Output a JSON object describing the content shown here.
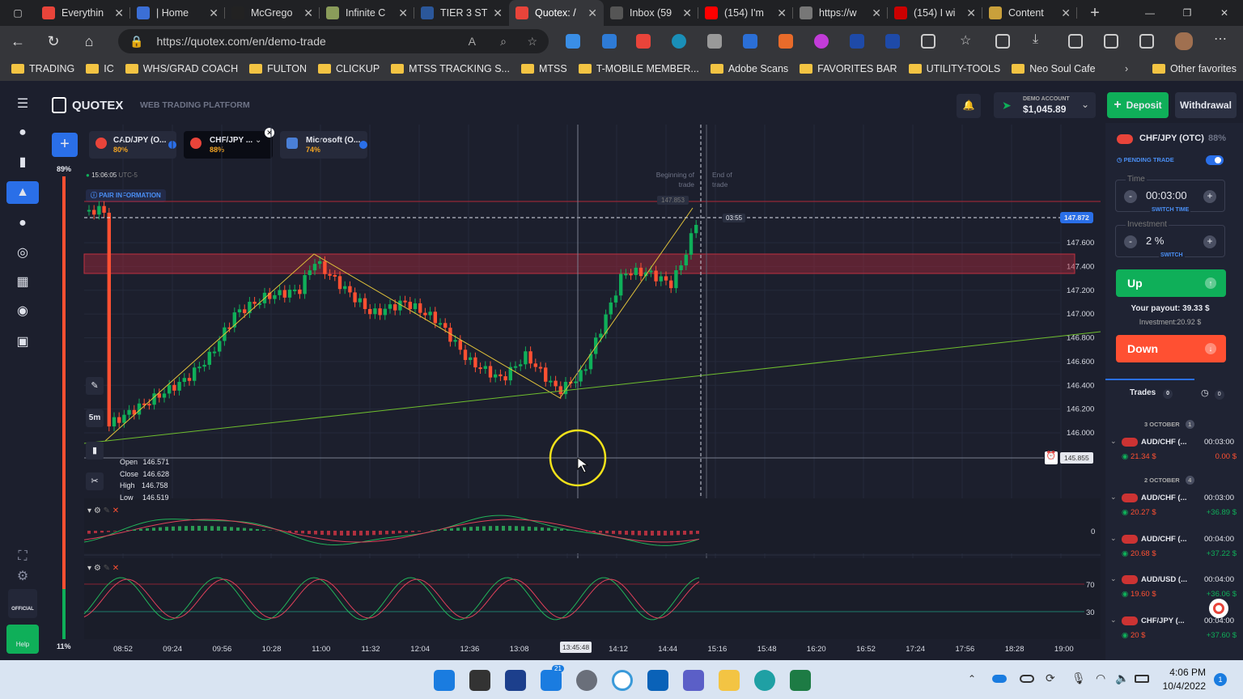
{
  "browser": {
    "tabs": [
      {
        "title": "Everythin",
        "color": "#e8443a"
      },
      {
        "title": "| Home",
        "color": "#3b6fd6"
      },
      {
        "title": "McGrego",
        "color": "#222"
      },
      {
        "title": "Infinite C",
        "color": "#8a9c5a"
      },
      {
        "title": "TIER 3 ST",
        "color": "#2b579a"
      },
      {
        "title": "Quotex: /",
        "color": "#e8443a"
      },
      {
        "title": "Inbox (59",
        "color": "#555"
      },
      {
        "title": "(154) I'm",
        "color": "#ff0000"
      },
      {
        "title": "https://w",
        "color": "#777"
      },
      {
        "title": "(154) I wi",
        "color": "#c00"
      },
      {
        "title": "Content",
        "color": "#c9a03b"
      }
    ],
    "url": "https://quotex.com/en/demo-trade",
    "favorites": [
      "TRADING",
      "IC",
      "WHS/GRAD COACH",
      "FULTON",
      "CLICKUP",
      "MTSS TRACKING S...",
      "MTSS",
      "T-MOBILE MEMBER...",
      "Adobe Scans",
      "FAVORITES BAR",
      "UTILITY-TOOLS",
      "Neo Soul Cafe"
    ],
    "other_favorites": "Other favorites"
  },
  "header": {
    "brand": "QUOTEX",
    "subtitle": "WEB TRADING PLATFORM",
    "account_type": "DEMO ACCOUNT",
    "balance": "$1,045.89",
    "deposit": "Deposit",
    "withdrawal": "Withdrawal"
  },
  "assets": [
    {
      "name": "CAD/JPY (O...",
      "payout": "80%"
    },
    {
      "name": "CHF/JPY ...",
      "payout": "88%"
    },
    {
      "name": "Microsoft (O...",
      "payout": "74%"
    }
  ],
  "chart": {
    "time": "15:06:05",
    "tz": "UTC-5",
    "pair_info": "PAIR INFORMATION",
    "timeframe": "5m",
    "percent_top": "89%",
    "percent_bottom": "11%",
    "beginning_label": "Beginning of trade",
    "end_label": "End of trade",
    "start_price": "147.853",
    "current_price": "147.872",
    "countdown": "03:55",
    "cursor_price": "145.855",
    "cursor_time": "13:45:48",
    "ohlc": {
      "open": "146.571",
      "close": "146.628",
      "high": "146.758",
      "low": "146.519"
    },
    "ohlc_labels": {
      "open": "Open",
      "close": "Close",
      "high": "High",
      "low": "Low"
    },
    "price_ticks": [
      "147.600",
      "147.400",
      "147.200",
      "147.000",
      "146.800",
      "146.600",
      "146.400",
      "146.200",
      "146.000"
    ],
    "time_ticks": [
      "08:52",
      "09:24",
      "09:56",
      "10:28",
      "11:00",
      "11:32",
      "12:04",
      "12:36",
      "13:08",
      "14:12",
      "14:44",
      "15:16",
      "15:48",
      "16:20",
      "16:52",
      "17:24",
      "17:56",
      "18:28",
      "19:00"
    ],
    "macd_zero": "0",
    "stoch_levels": [
      "70",
      "30"
    ]
  },
  "panel": {
    "pair": "CHF/JPY (OTC)",
    "payout": "88%",
    "pending": "PENDING TRADE",
    "time_label": "Time",
    "time_value": "00:03:00",
    "switch_time": "SWITCH TIME",
    "inv_label": "Investment",
    "inv_value": "2 %",
    "switch": "SWITCH",
    "up": "Up",
    "payout_text": "Your payout: 39.33 $",
    "investment_text": "Investment:20.92 $",
    "down": "Down",
    "trades_label": "Trades",
    "trades_count": "0",
    "history_count": "0",
    "date1": "3 OCTOBER",
    "date1_count": "1",
    "date2": "2 OCTOBER",
    "date2_count": "4",
    "trades": [
      {
        "pair": "AUD/CHF (...",
        "time": "00:03:00",
        "amount": "21.34 $",
        "result": "0.00 $",
        "result_color": "#ff5032"
      },
      {
        "pair": "AUD/CHF (...",
        "time": "00:03:00",
        "amount": "20.27 $",
        "result": "+36.89 $",
        "result_color": "#0faf59"
      },
      {
        "pair": "AUD/CHF (...",
        "time": "00:04:00",
        "amount": "20.68 $",
        "result": "+37.22 $",
        "result_color": "#0faf59"
      },
      {
        "pair": "AUD/USD (...",
        "time": "00:04:00",
        "amount": "19.60 $",
        "result": "+36.06 $",
        "result_color": "#0faf59"
      },
      {
        "pair": "CHF/JPY (...",
        "time": "00:04:00",
        "amount": "20 $",
        "result": "+37.60 $",
        "result_color": "#0faf59"
      }
    ]
  },
  "leftnav": {
    "official": "OFFICIAL",
    "help": "Help"
  },
  "taskbar": {
    "time": "4:06 PM",
    "date": "10/4/2022",
    "badge": "21",
    "notif": "1"
  }
}
